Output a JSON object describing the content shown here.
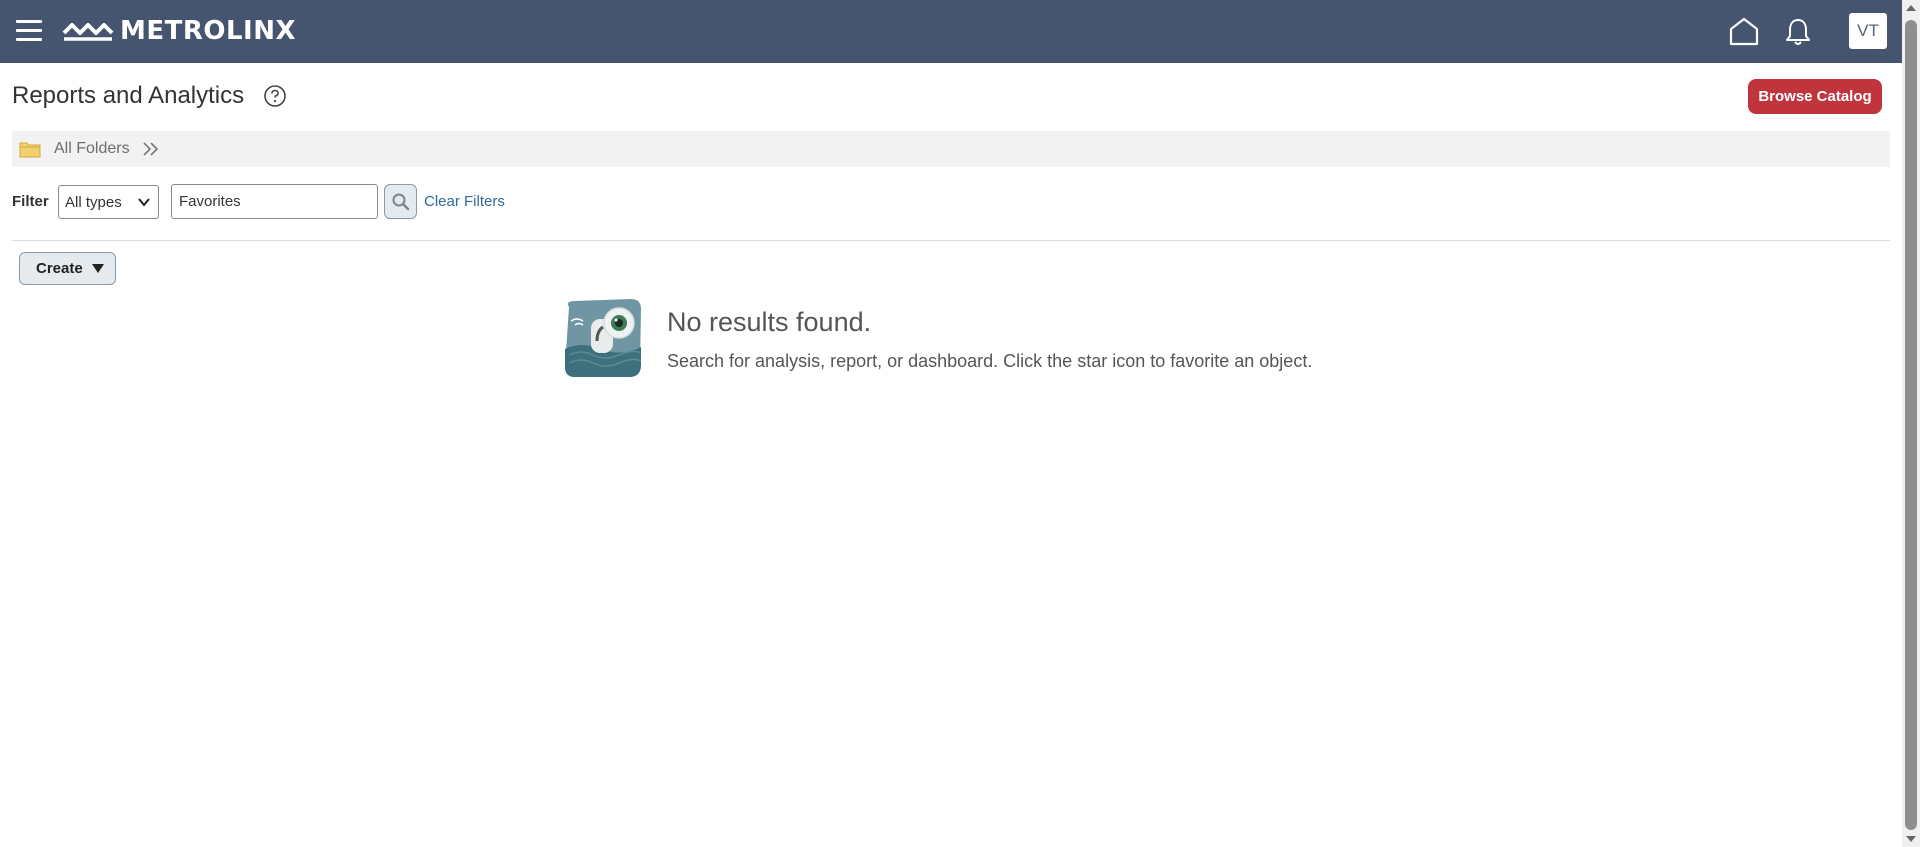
{
  "header": {
    "brand": "METROLINX",
    "menu_icon": "hamburger-menu-icon",
    "home_icon": "home-icon",
    "notifications_icon": "bell-icon",
    "avatar_initials": "VT",
    "bar_color": "#455570"
  },
  "page": {
    "title": "Reports and Analytics",
    "help_icon": "help-question-icon",
    "browse_catalog_label": "Browse Catalog",
    "accent_color": "#c0343d"
  },
  "breadcrumb": {
    "folder_icon": "folder-icon",
    "label": "All Folders",
    "chevrons_icon": "double-chevron-right-icon"
  },
  "filter": {
    "label": "Filter",
    "type_selected": "All types",
    "search_value": "Favorites",
    "search_icon": "magnifier-icon",
    "clear_label": "Clear Filters"
  },
  "toolbar": {
    "create_label": "Create"
  },
  "empty_state": {
    "illustration": "binoculars-illustration",
    "title": "No results found.",
    "message": "Search for analysis, report, or dashboard. Click the star icon to favorite an object."
  }
}
